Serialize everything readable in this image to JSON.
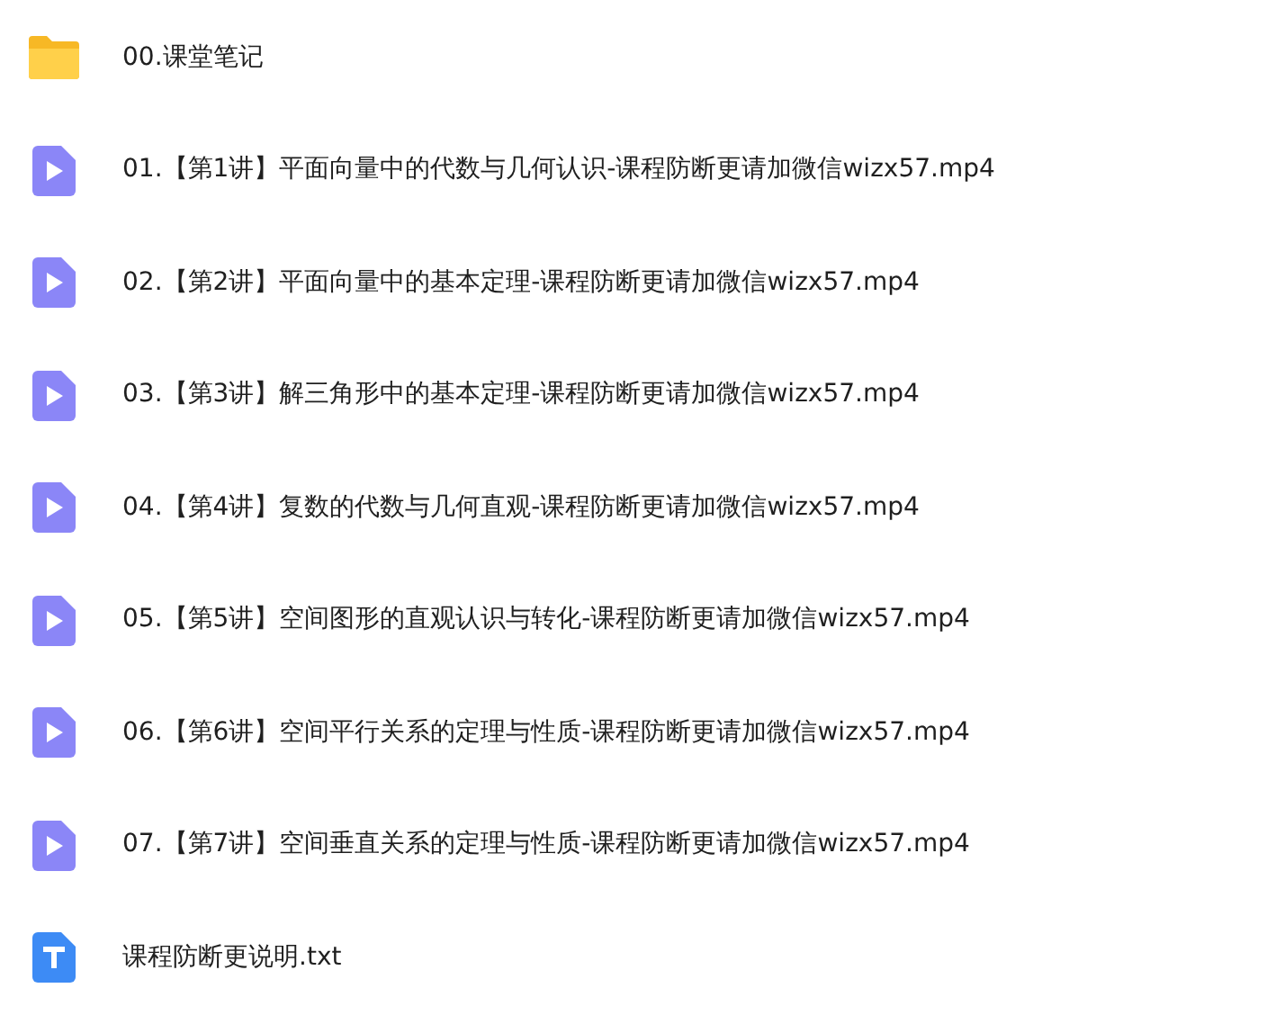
{
  "files": [
    {
      "kind": "folder",
      "name": "00.课堂笔记"
    },
    {
      "kind": "video",
      "name": "01.【第1讲】平面向量中的代数与几何认识-课程防断更请加微信wizx57.mp4"
    },
    {
      "kind": "video",
      "name": "02.【第2讲】平面向量中的基本定理-课程防断更请加微信wizx57.mp4"
    },
    {
      "kind": "video",
      "name": "03.【第3讲】解三角形中的基本定理-课程防断更请加微信wizx57.mp4"
    },
    {
      "kind": "video",
      "name": "04.【第4讲】复数的代数与几何直观-课程防断更请加微信wizx57.mp4"
    },
    {
      "kind": "video",
      "name": "05.【第5讲】空间图形的直观认识与转化-课程防断更请加微信wizx57.mp4"
    },
    {
      "kind": "video",
      "name": "06.【第6讲】空间平行关系的定理与性质-课程防断更请加微信wizx57.mp4"
    },
    {
      "kind": "video",
      "name": "07.【第7讲】空间垂直关系的定理与性质-课程防断更请加微信wizx57.mp4"
    },
    {
      "kind": "text",
      "name": "课程防断更说明.txt"
    }
  ]
}
